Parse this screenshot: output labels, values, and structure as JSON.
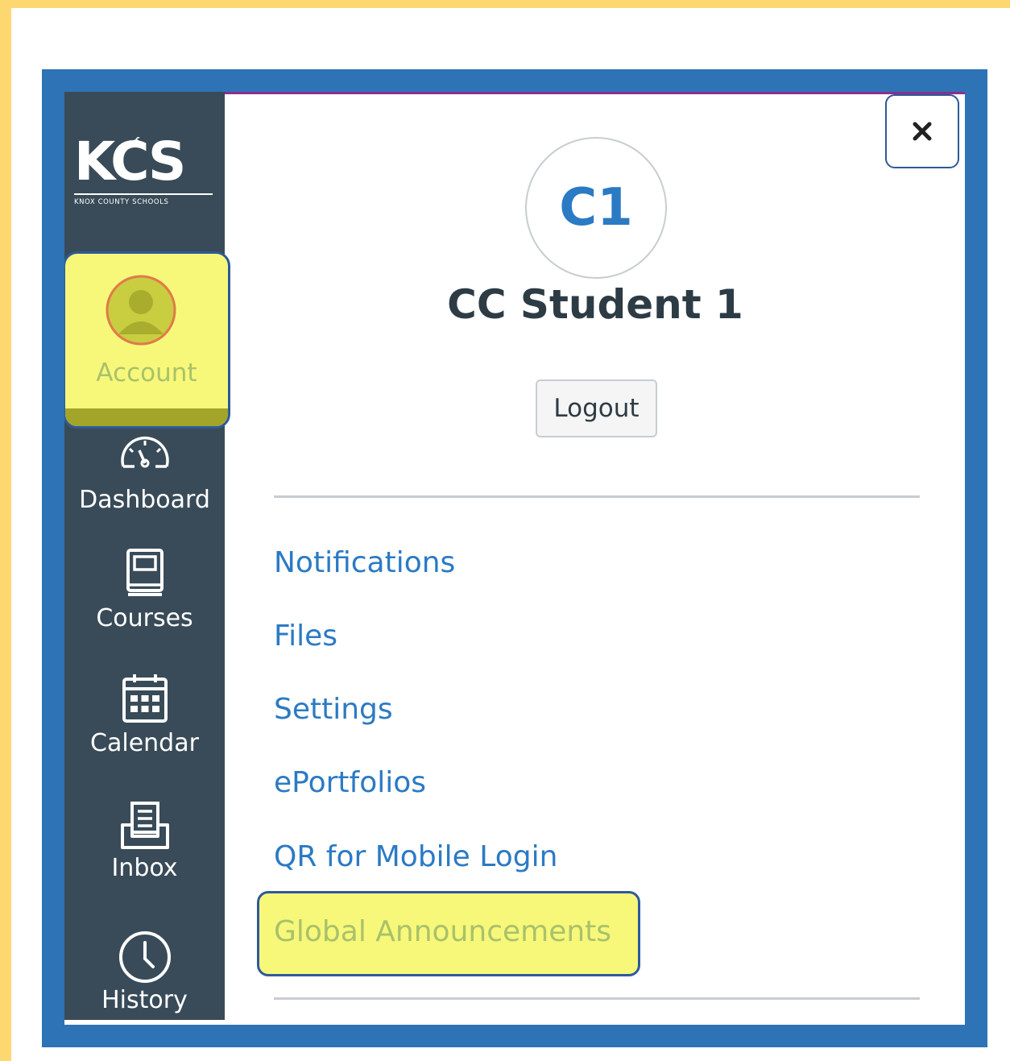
{
  "sidebar": {
    "logo": {
      "text": "KCS",
      "subtitle": "KNOX COUNTY SCHOOLS"
    },
    "items": [
      {
        "label": "Account",
        "icon": "user-avatar-icon",
        "highlighted": true
      },
      {
        "label": "Dashboard",
        "icon": "speedometer-icon"
      },
      {
        "label": "Courses",
        "icon": "book-icon"
      },
      {
        "label": "Calendar",
        "icon": "calendar-icon"
      },
      {
        "label": "Inbox",
        "icon": "inbox-icon"
      },
      {
        "label": "History",
        "icon": "clock-icon"
      }
    ]
  },
  "tray": {
    "close_label": "×",
    "avatar_initials": "C1",
    "user_name": "CC Student 1",
    "logout_label": "Logout",
    "links": [
      {
        "label": "Notifications"
      },
      {
        "label": "Files"
      },
      {
        "label": "Settings"
      },
      {
        "label": "ePortfolios"
      },
      {
        "label": "QR for Mobile Login"
      },
      {
        "label": "Global Announcements",
        "highlighted": true
      }
    ]
  },
  "colors": {
    "page_border": "#fdd770",
    "frame": "#2e73b5",
    "sidebar_bg": "#394b58",
    "highlight": "#f7f87a",
    "link": "#2b7ac4",
    "text_dark": "#2d3b45"
  }
}
